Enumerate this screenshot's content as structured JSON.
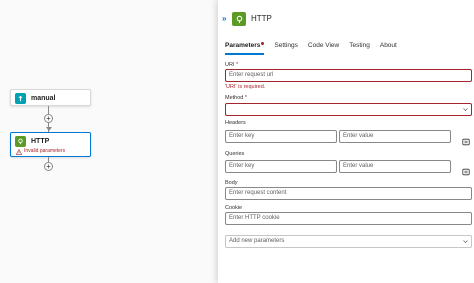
{
  "canvas": {
    "trigger": {
      "title": "manual"
    },
    "action": {
      "title": "HTTP",
      "error": "Invalid parameters"
    },
    "add_symbol": "+"
  },
  "panel": {
    "collapse_symbol": "»",
    "title": "HTTP",
    "tabs": [
      {
        "label": "Parameters",
        "required_dot": true
      },
      {
        "label": "Settings"
      },
      {
        "label": "Code View"
      },
      {
        "label": "Testing"
      },
      {
        "label": "About"
      }
    ],
    "uri": {
      "label": "URI",
      "required": "*",
      "placeholder": "Enter request url",
      "error": "'URI' is required."
    },
    "method": {
      "label": "Method",
      "required": "*",
      "value": ""
    },
    "headers": {
      "label": "Headers",
      "key_placeholder": "Enter key",
      "value_placeholder": "Enter value"
    },
    "queries": {
      "label": "Queries",
      "key_placeholder": "Enter key",
      "value_placeholder": "Enter value"
    },
    "body": {
      "label": "Body",
      "placeholder": "Enter request content"
    },
    "cookie": {
      "label": "Cookie",
      "placeholder": "Enter HTTP cookie"
    },
    "add_params": {
      "label": "Add new parameters"
    }
  },
  "colors": {
    "accent": "#0078d4",
    "error": "#a4262c",
    "http_icon": "#5b9a24",
    "trigger_icon": "#00a1b2"
  },
  "icons": [
    "trigger-icon",
    "http-icon",
    "warning-icon",
    "chevron-down-icon",
    "delete-icon",
    "collapse-icon"
  ]
}
